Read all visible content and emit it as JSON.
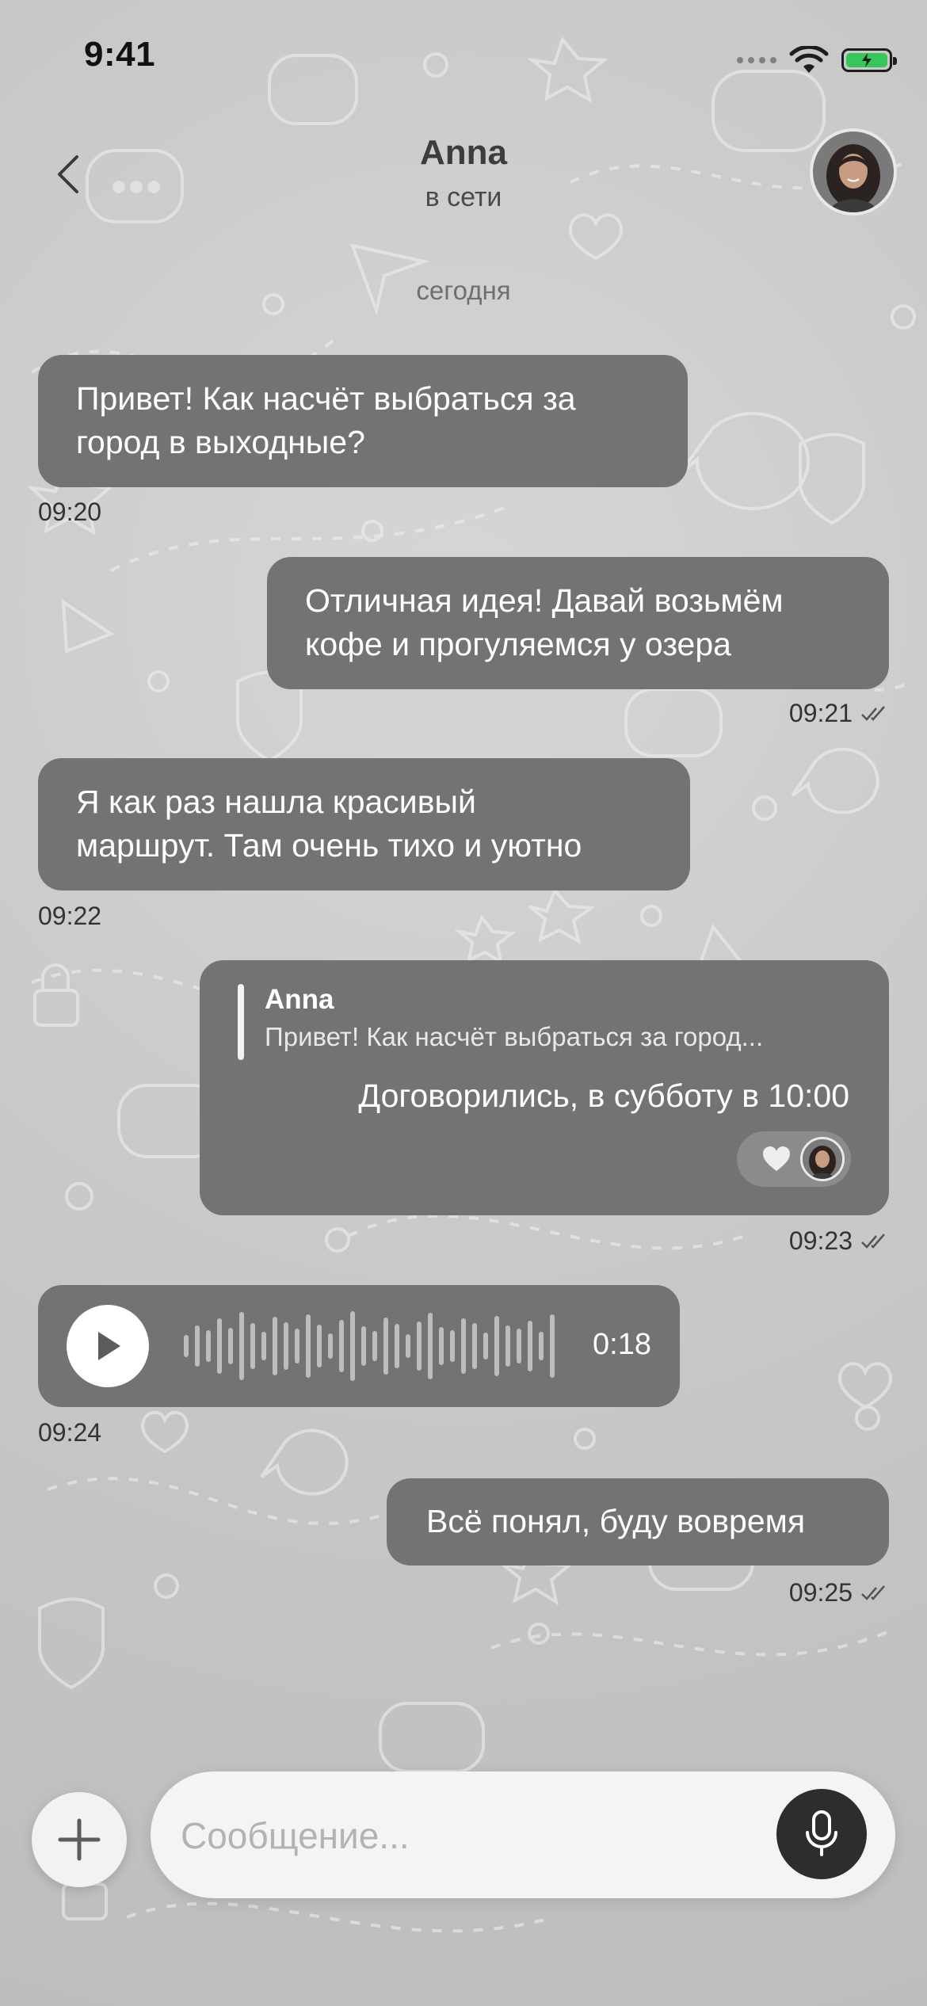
{
  "status_bar": {
    "time": "9:41"
  },
  "header": {
    "name": "Anna",
    "status": "в сети"
  },
  "date_separator": "сегодня",
  "messages": [
    {
      "id": 1,
      "type": "text",
      "direction": "in",
      "text_line1": "Привет! Как насчёт выбраться за",
      "text_line2": "город в выходные?",
      "time": "09:20"
    },
    {
      "id": 2,
      "type": "text",
      "direction": "out",
      "text_line1": "Отличная идея! Давай возьмём",
      "text_line2": "кофе и прогуляемся у озера",
      "time": "09:21",
      "read": true
    },
    {
      "id": 3,
      "type": "text",
      "direction": "in",
      "text_line1": "Я как раз нашла красивый",
      "text_line2": "маршрут. Там очень тихо и уютно",
      "time": "09:22"
    },
    {
      "id": 4,
      "type": "reply",
      "direction": "out",
      "reply_to_name": "Anna",
      "reply_to_snippet": "Привет! Как насчёт выбраться за город...",
      "text": "Договорились, в субботу в 10:00",
      "time": "09:23",
      "read": true,
      "reaction": "heart"
    },
    {
      "id": 5,
      "type": "voice",
      "direction": "in",
      "duration": "0:18",
      "time": "09:24"
    },
    {
      "id": 6,
      "type": "text",
      "direction": "out",
      "text": "Всё понял, буду вовремя",
      "time": "09:25",
      "read": true
    }
  ],
  "composer": {
    "placeholder": "Сообщение..."
  },
  "colors": {
    "bubble": "#737373",
    "background": "#c9c9c9",
    "mic_button": "#2d2d2d",
    "battery": "#35c759"
  }
}
